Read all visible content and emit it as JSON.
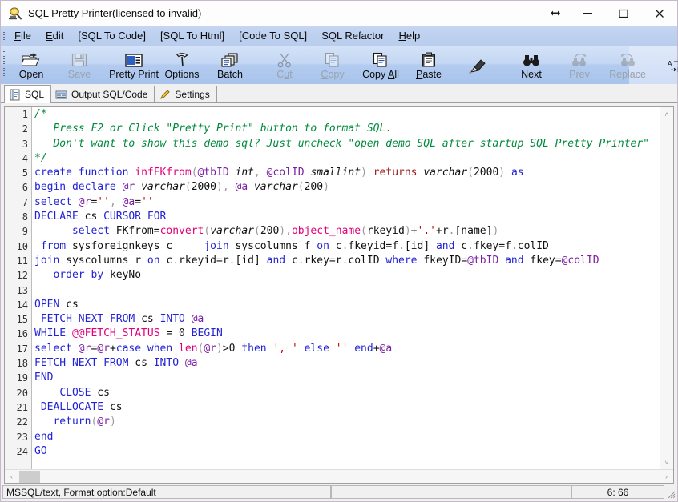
{
  "window": {
    "title": "SQL Pretty Printer(licensed to invalid)",
    "icon": "app-logo-icon",
    "buttons": {
      "restore_arrows": "↔",
      "minimize": "—",
      "maximize": "☐",
      "close": "✕"
    }
  },
  "menubar": {
    "items": [
      {
        "label": "File",
        "mnemonic": "F"
      },
      {
        "label": "Edit",
        "mnemonic": "E"
      },
      {
        "label": "[SQL To Code]",
        "mnemonic": ""
      },
      {
        "label": "[SQL To Html]",
        "mnemonic": ""
      },
      {
        "label": "[Code To SQL]",
        "mnemonic": ""
      },
      {
        "label": "SQL Refactor",
        "mnemonic": ""
      },
      {
        "label": "Help",
        "mnemonic": "H"
      }
    ]
  },
  "toolbar": {
    "buttons": [
      {
        "label": "Open",
        "icon": "open-folder-icon",
        "enabled": true
      },
      {
        "label": "Save",
        "icon": "save-disk-icon",
        "enabled": false
      },
      {
        "sep": true
      },
      {
        "label": "Pretty Print",
        "icon": "pretty-print-icon",
        "enabled": true
      },
      {
        "label": "Options",
        "icon": "hammer-icon",
        "enabled": true
      },
      {
        "label": "Batch",
        "icon": "batch-icon",
        "enabled": true
      },
      {
        "sep": true
      },
      {
        "label": "Cut",
        "icon": "scissors-icon",
        "enabled": false
      },
      {
        "label": "Copy",
        "icon": "copy-icon",
        "enabled": false
      },
      {
        "label": "Copy All",
        "icon": "copy-all-icon",
        "enabled": true
      },
      {
        "label": "Paste",
        "icon": "clipboard-icon",
        "enabled": true
      },
      {
        "label": "Clear All",
        "icon": "eraser-icon",
        "enabled": true
      },
      {
        "sep": true
      },
      {
        "label": "Search",
        "icon": "binoculars-icon",
        "enabled": true
      },
      {
        "label": "Next",
        "icon": "search-next-icon",
        "enabled": false
      },
      {
        "label": "Prev",
        "icon": "search-prev-icon",
        "enabled": false
      },
      {
        "label": "Replace",
        "icon": "replace-ab-icon",
        "enabled": true
      }
    ]
  },
  "tabs": [
    {
      "label": "SQL",
      "icon": "sql-doc-icon",
      "active": true
    },
    {
      "label": "Output SQL/Code",
      "icon": "output-icon",
      "active": false
    },
    {
      "label": "Settings",
      "icon": "pencil-icon",
      "active": false
    }
  ],
  "editor": {
    "line_numbers": [
      1,
      2,
      3,
      4,
      5,
      6,
      7,
      8,
      9,
      10,
      11,
      12,
      13,
      14,
      15,
      16,
      17,
      18,
      19,
      20,
      21,
      22,
      23,
      24
    ],
    "lines": [
      [
        {
          "t": "/*",
          "c": "cmt"
        }
      ],
      [
        {
          "t": "   Press F2 or Click \"Pretty Print\" button to format SQL.",
          "c": "cmt"
        }
      ],
      [
        {
          "t": "   Don't want to show this demo sql? Just uncheck \"open demo SQL after startup SQL Pretty Printer\"",
          "c": "cmt"
        }
      ],
      [
        {
          "t": "*/",
          "c": "cmt"
        }
      ],
      [
        {
          "t": "create",
          "c": "kw"
        },
        {
          "t": " ",
          "c": "op"
        },
        {
          "t": "function",
          "c": "kw"
        },
        {
          "t": " ",
          "c": "op"
        },
        {
          "t": "infFKfrom",
          "c": "fn"
        },
        {
          "t": "(",
          "c": "punct"
        },
        {
          "t": "@tbID",
          "c": "var"
        },
        {
          "t": " ",
          "c": "op"
        },
        {
          "t": "int",
          "c": "typ"
        },
        {
          "t": ",",
          "c": "punct"
        },
        {
          "t": " ",
          "c": "op"
        },
        {
          "t": "@colID",
          "c": "var"
        },
        {
          "t": " ",
          "c": "op"
        },
        {
          "t": "smallint",
          "c": "typ"
        },
        {
          "t": ")",
          "c": "punct"
        },
        {
          "t": " ",
          "c": "op"
        },
        {
          "t": "returns",
          "c": "ret"
        },
        {
          "t": " ",
          "c": "op"
        },
        {
          "t": "varchar",
          "c": "typ"
        },
        {
          "t": "(",
          "c": "punct"
        },
        {
          "t": "2000",
          "c": "num"
        },
        {
          "t": ")",
          "c": "punct"
        },
        {
          "t": " ",
          "c": "op"
        },
        {
          "t": "as",
          "c": "kw"
        }
      ],
      [
        {
          "t": "begin",
          "c": "kw"
        },
        {
          "t": " ",
          "c": "op"
        },
        {
          "t": "declare",
          "c": "kw"
        },
        {
          "t": " ",
          "c": "op"
        },
        {
          "t": "@r",
          "c": "var"
        },
        {
          "t": " ",
          "c": "op"
        },
        {
          "t": "varchar",
          "c": "typ"
        },
        {
          "t": "(",
          "c": "punct"
        },
        {
          "t": "2000",
          "c": "num"
        },
        {
          "t": ")",
          "c": "punct"
        },
        {
          "t": ", ",
          "c": "punct"
        },
        {
          "t": "@a",
          "c": "var"
        },
        {
          "t": " ",
          "c": "op"
        },
        {
          "t": "varchar",
          "c": "typ"
        },
        {
          "t": "(",
          "c": "punct"
        },
        {
          "t": "200",
          "c": "num"
        },
        {
          "t": ")",
          "c": "punct"
        }
      ],
      [
        {
          "t": "select",
          "c": "kw"
        },
        {
          "t": " ",
          "c": "op"
        },
        {
          "t": "@r",
          "c": "var"
        },
        {
          "t": "=",
          "c": "op"
        },
        {
          "t": "''",
          "c": "str"
        },
        {
          "t": ", ",
          "c": "punct"
        },
        {
          "t": "@a",
          "c": "var"
        },
        {
          "t": "=",
          "c": "op"
        },
        {
          "t": "''",
          "c": "str"
        }
      ],
      [
        {
          "t": "DECLARE",
          "c": "kw"
        },
        {
          "t": " ",
          "c": "op"
        },
        {
          "t": "cs",
          "c": "id"
        },
        {
          "t": " ",
          "c": "op"
        },
        {
          "t": "CURSOR",
          "c": "kw"
        },
        {
          "t": " ",
          "c": "op"
        },
        {
          "t": "FOR",
          "c": "kw"
        }
      ],
      [
        {
          "t": "      ",
          "c": "op"
        },
        {
          "t": "select",
          "c": "kw"
        },
        {
          "t": " ",
          "c": "op"
        },
        {
          "t": "FKfrom",
          "c": "id"
        },
        {
          "t": "=",
          "c": "op"
        },
        {
          "t": "convert",
          "c": "fn"
        },
        {
          "t": "(",
          "c": "punct"
        },
        {
          "t": "varchar",
          "c": "typ"
        },
        {
          "t": "(",
          "c": "punct"
        },
        {
          "t": "200",
          "c": "num"
        },
        {
          "t": ")",
          "c": "punct"
        },
        {
          "t": ",",
          "c": "punct"
        },
        {
          "t": "object_name",
          "c": "fn"
        },
        {
          "t": "(",
          "c": "punct"
        },
        {
          "t": "rkeyid",
          "c": "id"
        },
        {
          "t": ")",
          "c": "punct"
        },
        {
          "t": "+",
          "c": "op"
        },
        {
          "t": "'.'",
          "c": "str"
        },
        {
          "t": "+",
          "c": "op"
        },
        {
          "t": "r",
          "c": "id"
        },
        {
          "t": ".",
          "c": "punct"
        },
        {
          "t": "[name]",
          "c": "id"
        },
        {
          "t": ")",
          "c": "punct"
        }
      ],
      [
        {
          "t": " ",
          "c": "op"
        },
        {
          "t": "from",
          "c": "kw"
        },
        {
          "t": " ",
          "c": "op"
        },
        {
          "t": "sysforeignkeys",
          "c": "id"
        },
        {
          "t": " ",
          "c": "op"
        },
        {
          "t": "c",
          "c": "id"
        },
        {
          "t": "     ",
          "c": "op"
        },
        {
          "t": "join",
          "c": "kw"
        },
        {
          "t": " ",
          "c": "op"
        },
        {
          "t": "syscolumns",
          "c": "id"
        },
        {
          "t": " ",
          "c": "op"
        },
        {
          "t": "f",
          "c": "id"
        },
        {
          "t": " ",
          "c": "op"
        },
        {
          "t": "on",
          "c": "kw"
        },
        {
          "t": " ",
          "c": "op"
        },
        {
          "t": "c",
          "c": "id"
        },
        {
          "t": ".",
          "c": "punct"
        },
        {
          "t": "fkeyid",
          "c": "id"
        },
        {
          "t": "=",
          "c": "op"
        },
        {
          "t": "f",
          "c": "id"
        },
        {
          "t": ".",
          "c": "punct"
        },
        {
          "t": "[id]",
          "c": "id"
        },
        {
          "t": " ",
          "c": "op"
        },
        {
          "t": "and",
          "c": "kw"
        },
        {
          "t": " ",
          "c": "op"
        },
        {
          "t": "c",
          "c": "id"
        },
        {
          "t": ".",
          "c": "punct"
        },
        {
          "t": "fkey",
          "c": "id"
        },
        {
          "t": "=",
          "c": "op"
        },
        {
          "t": "f",
          "c": "id"
        },
        {
          "t": ".",
          "c": "punct"
        },
        {
          "t": "colID",
          "c": "id"
        }
      ],
      [
        {
          "t": "join",
          "c": "kw"
        },
        {
          "t": " ",
          "c": "op"
        },
        {
          "t": "syscolumns",
          "c": "id"
        },
        {
          "t": " ",
          "c": "op"
        },
        {
          "t": "r",
          "c": "id"
        },
        {
          "t": " ",
          "c": "op"
        },
        {
          "t": "on",
          "c": "kw"
        },
        {
          "t": " ",
          "c": "op"
        },
        {
          "t": "c",
          "c": "id"
        },
        {
          "t": ".",
          "c": "punct"
        },
        {
          "t": "rkeyid",
          "c": "id"
        },
        {
          "t": "=",
          "c": "op"
        },
        {
          "t": "r",
          "c": "id"
        },
        {
          "t": ".",
          "c": "punct"
        },
        {
          "t": "[id]",
          "c": "id"
        },
        {
          "t": " ",
          "c": "op"
        },
        {
          "t": "and",
          "c": "kw"
        },
        {
          "t": " ",
          "c": "op"
        },
        {
          "t": "c",
          "c": "id"
        },
        {
          "t": ".",
          "c": "punct"
        },
        {
          "t": "rkey",
          "c": "id"
        },
        {
          "t": "=",
          "c": "op"
        },
        {
          "t": "r",
          "c": "id"
        },
        {
          "t": ".",
          "c": "punct"
        },
        {
          "t": "colID",
          "c": "id"
        },
        {
          "t": " ",
          "c": "op"
        },
        {
          "t": "where",
          "c": "kw"
        },
        {
          "t": " ",
          "c": "op"
        },
        {
          "t": "fkeyID",
          "c": "id"
        },
        {
          "t": "=",
          "c": "op"
        },
        {
          "t": "@tbID",
          "c": "var"
        },
        {
          "t": " ",
          "c": "op"
        },
        {
          "t": "and",
          "c": "kw"
        },
        {
          "t": " ",
          "c": "op"
        },
        {
          "t": "fkey",
          "c": "id"
        },
        {
          "t": "=",
          "c": "op"
        },
        {
          "t": "@colID",
          "c": "var"
        }
      ],
      [
        {
          "t": "   ",
          "c": "op"
        },
        {
          "t": "order",
          "c": "kw"
        },
        {
          "t": " ",
          "c": "op"
        },
        {
          "t": "by",
          "c": "kw"
        },
        {
          "t": " ",
          "c": "op"
        },
        {
          "t": "keyNo",
          "c": "id"
        }
      ],
      [],
      [
        {
          "t": "OPEN",
          "c": "kw"
        },
        {
          "t": " ",
          "c": "op"
        },
        {
          "t": "cs",
          "c": "id"
        }
      ],
      [
        {
          "t": " ",
          "c": "op"
        },
        {
          "t": "FETCH",
          "c": "kw"
        },
        {
          "t": " ",
          "c": "op"
        },
        {
          "t": "NEXT",
          "c": "kw"
        },
        {
          "t": " ",
          "c": "op"
        },
        {
          "t": "FROM",
          "c": "kw"
        },
        {
          "t": " ",
          "c": "op"
        },
        {
          "t": "cs",
          "c": "id"
        },
        {
          "t": " ",
          "c": "op"
        },
        {
          "t": "INTO",
          "c": "kw"
        },
        {
          "t": " ",
          "c": "op"
        },
        {
          "t": "@a",
          "c": "var"
        }
      ],
      [
        {
          "t": "WHILE",
          "c": "kw"
        },
        {
          "t": " ",
          "c": "op"
        },
        {
          "t": "@@FETCH_STATUS",
          "c": "fn"
        },
        {
          "t": " ",
          "c": "op"
        },
        {
          "t": "=",
          "c": "op"
        },
        {
          "t": " ",
          "c": "op"
        },
        {
          "t": "0",
          "c": "num"
        },
        {
          "t": " ",
          "c": "op"
        },
        {
          "t": "BEGIN",
          "c": "kw"
        }
      ],
      [
        {
          "t": "select",
          "c": "kw"
        },
        {
          "t": " ",
          "c": "op"
        },
        {
          "t": "@r",
          "c": "var"
        },
        {
          "t": "=",
          "c": "op"
        },
        {
          "t": "@r",
          "c": "var"
        },
        {
          "t": "+",
          "c": "op"
        },
        {
          "t": "case",
          "c": "kw"
        },
        {
          "t": " ",
          "c": "op"
        },
        {
          "t": "when",
          "c": "kw"
        },
        {
          "t": " ",
          "c": "op"
        },
        {
          "t": "len",
          "c": "fn"
        },
        {
          "t": "(",
          "c": "punct"
        },
        {
          "t": "@r",
          "c": "var"
        },
        {
          "t": ")",
          "c": "punct"
        },
        {
          "t": ">",
          "c": "op"
        },
        {
          "t": "0",
          "c": "num"
        },
        {
          "t": " ",
          "c": "op"
        },
        {
          "t": "then",
          "c": "kw"
        },
        {
          "t": " ",
          "c": "op"
        },
        {
          "t": "', '",
          "c": "str"
        },
        {
          "t": " ",
          "c": "op"
        },
        {
          "t": "else",
          "c": "kw"
        },
        {
          "t": " ",
          "c": "op"
        },
        {
          "t": "''",
          "c": "str"
        },
        {
          "t": " ",
          "c": "op"
        },
        {
          "t": "end",
          "c": "kw"
        },
        {
          "t": "+",
          "c": "op"
        },
        {
          "t": "@a",
          "c": "var"
        }
      ],
      [
        {
          "t": "FETCH",
          "c": "kw"
        },
        {
          "t": " ",
          "c": "op"
        },
        {
          "t": "NEXT",
          "c": "kw"
        },
        {
          "t": " ",
          "c": "op"
        },
        {
          "t": "FROM",
          "c": "kw"
        },
        {
          "t": " ",
          "c": "op"
        },
        {
          "t": "cs",
          "c": "id"
        },
        {
          "t": " ",
          "c": "op"
        },
        {
          "t": "INTO",
          "c": "kw"
        },
        {
          "t": " ",
          "c": "op"
        },
        {
          "t": "@a",
          "c": "var"
        }
      ],
      [
        {
          "t": "END",
          "c": "kw"
        }
      ],
      [
        {
          "t": "    ",
          "c": "op"
        },
        {
          "t": "CLOSE",
          "c": "kw"
        },
        {
          "t": " ",
          "c": "op"
        },
        {
          "t": "cs",
          "c": "id"
        }
      ],
      [
        {
          "t": " ",
          "c": "op"
        },
        {
          "t": "DEALLOCATE",
          "c": "kw"
        },
        {
          "t": " ",
          "c": "op"
        },
        {
          "t": "cs",
          "c": "id"
        }
      ],
      [
        {
          "t": "   ",
          "c": "op"
        },
        {
          "t": "return",
          "c": "kw"
        },
        {
          "t": "(",
          "c": "punct"
        },
        {
          "t": "@r",
          "c": "var"
        },
        {
          "t": ")",
          "c": "punct"
        }
      ],
      [
        {
          "t": "end",
          "c": "kw"
        }
      ],
      [
        {
          "t": "GO",
          "c": "kw"
        }
      ]
    ],
    "scroll": {
      "v_up": "˄",
      "v_down": "˅",
      "h_left": "‹",
      "h_right": "›"
    }
  },
  "statusbar": {
    "format_info": "MSSQL/text, Format option:Default",
    "middle": "",
    "caret_position": "6: 66"
  },
  "colors": {
    "menu_bg": "#bdd0ef",
    "toolbar_top": "#d3e2f7",
    "toolbar_bottom": "#a8c3ec",
    "comment": "#008a3c",
    "keyword": "#2323d6",
    "function": "#e2007a",
    "string": "#c00000",
    "variable": "#7a1fa2",
    "returns": "#9c1a1a"
  }
}
